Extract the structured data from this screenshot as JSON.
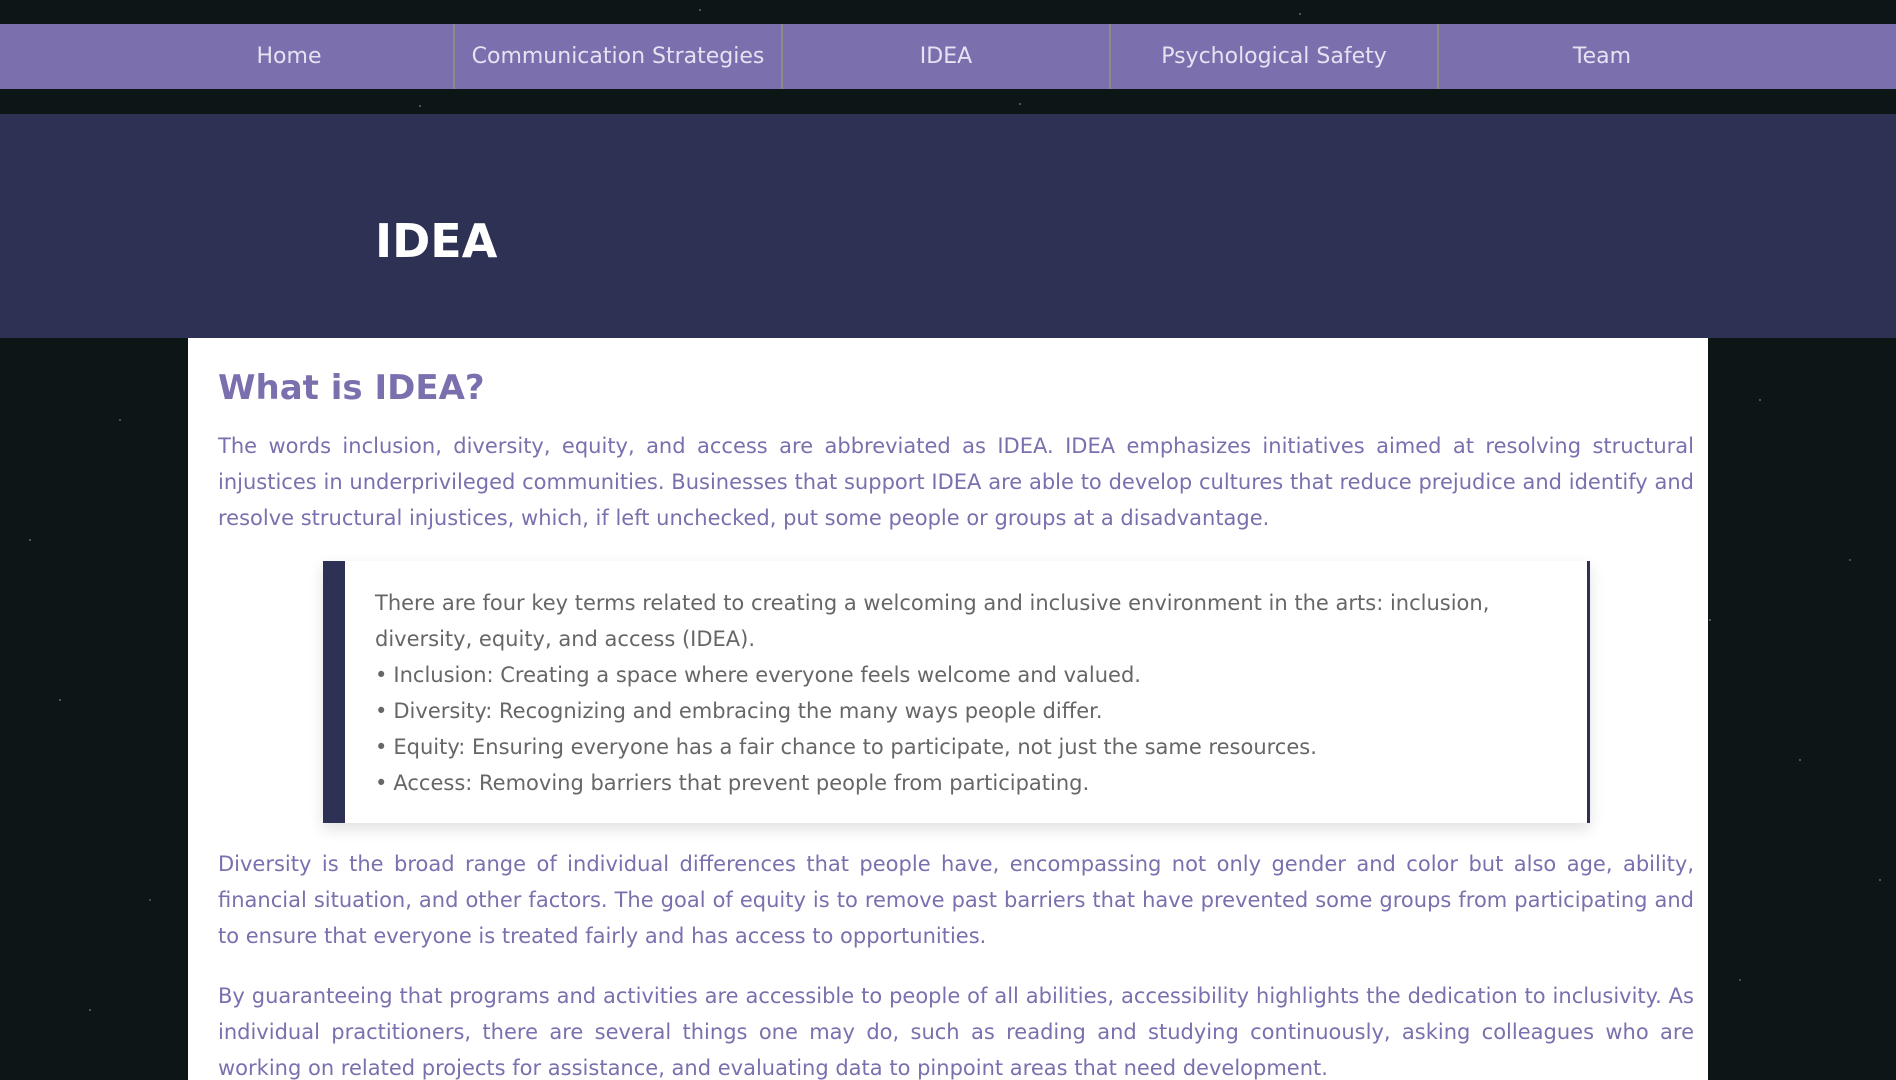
{
  "nav": {
    "items": [
      {
        "label": "Home"
      },
      {
        "label": "Communication Strategies"
      },
      {
        "label": "IDEA"
      },
      {
        "label": "Psychological Safety"
      },
      {
        "label": "Team"
      }
    ]
  },
  "hero": {
    "title": "IDEA"
  },
  "main": {
    "heading": "What is IDEA?",
    "intro": "The words inclusion, diversity, equity, and access are abbreviated as IDEA. IDEA emphasizes initiatives aimed at resolving structural injustices in underprivileged communities. Businesses that support IDEA are able to develop cultures that reduce prejudice and identify and resolve structural injustices, which, if left unchecked, put some people or groups at a disadvantage.",
    "callout": {
      "lead": "There are four key terms related to creating a welcoming and inclusive environment in the arts: inclusion, diversity, equity, and access (IDEA).",
      "items": [
        "Inclusion: Creating a space where everyone feels welcome and valued.",
        "Diversity: Recognizing and embracing the many ways people differ.",
        "Equity: Ensuring everyone has a fair chance to participate, not just the same resources.",
        "Access: Removing barriers that prevent people from participating."
      ]
    },
    "paragraph_diversity": "Diversity is the broad range of individual differences that people have, encompassing not only gender and color but also age, ability, financial situation, and other factors. The goal of equity is to remove past barriers that have prevented some groups from participating and to ensure that everyone is treated fairly and has access to opportunities.",
    "paragraph_access": "By guaranteeing that programs and activities are accessible to people of all abilities, accessibility highlights the dedication to inclusivity. As individual practitioners, there are several things one may do, such as reading and studying continuously, asking colleagues who are working on related projects for assistance, and evaluating data to pinpoint areas that need development."
  },
  "colors": {
    "nav_bg": "#7b6fae",
    "hero_bg": "#2d3153",
    "accent_text": "#7b6fae",
    "callout_text": "#666666"
  }
}
